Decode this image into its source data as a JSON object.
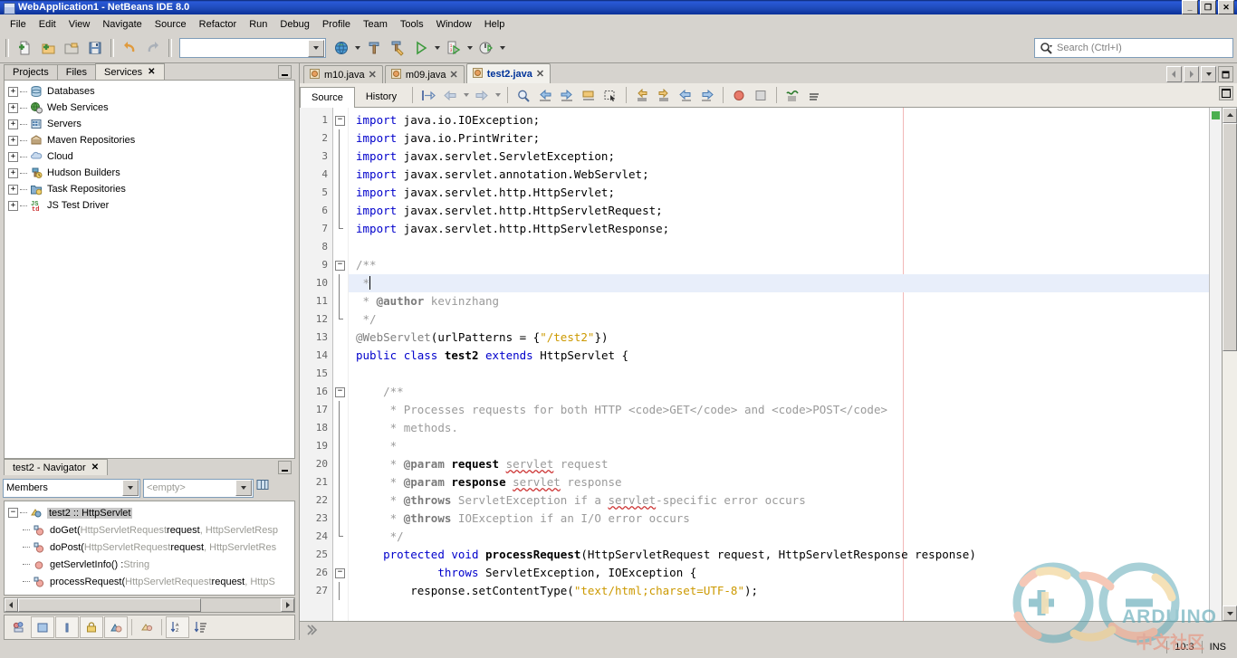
{
  "window": {
    "title": "WebApplication1 - NetBeans IDE 8.0",
    "icon": "netbeans-cube-icon",
    "minimize": "_",
    "maximize": "❐",
    "close": "✕"
  },
  "menubar": {
    "items": [
      {
        "label": "File"
      },
      {
        "label": "Edit"
      },
      {
        "label": "View"
      },
      {
        "label": "Navigate"
      },
      {
        "label": "Source"
      },
      {
        "label": "Refactor"
      },
      {
        "label": "Run"
      },
      {
        "label": "Debug"
      },
      {
        "label": "Profile"
      },
      {
        "label": "Team"
      },
      {
        "label": "Tools"
      },
      {
        "label": "Window"
      },
      {
        "label": "Help"
      }
    ]
  },
  "toolbar": {
    "buttons": [
      {
        "name": "new-file-icon",
        "title": "New File"
      },
      {
        "name": "new-project-icon",
        "title": "New Project"
      },
      {
        "name": "open-project-icon",
        "title": "Open Project"
      },
      {
        "name": "save-all-icon",
        "title": "Save All"
      },
      {
        "name": "undo-icon",
        "title": "Undo"
      },
      {
        "name": "redo-icon",
        "title": "Redo"
      },
      {
        "name": "globe-icon",
        "title": "Deploy"
      },
      {
        "name": "build-hammer-icon",
        "title": "Build Project"
      },
      {
        "name": "clean-build-icon",
        "title": "Clean and Build Project"
      },
      {
        "name": "run-project-icon",
        "title": "Run Project"
      },
      {
        "name": "debug-project-icon",
        "title": "Debug Project"
      },
      {
        "name": "profile-project-icon",
        "title": "Profile Project"
      }
    ],
    "config_combo": {
      "value": "",
      "placeholder": ""
    }
  },
  "search": {
    "placeholder": "Search (Ctrl+I)",
    "value": "",
    "icon": "search-icon"
  },
  "explorer": {
    "tabs": [
      {
        "label": "Projects",
        "active": false,
        "closable": false
      },
      {
        "label": "Files",
        "active": false,
        "closable": false
      },
      {
        "label": "Services",
        "active": true,
        "closable": true
      }
    ],
    "close_glyph": "✕",
    "tree": [
      {
        "label": "Databases",
        "icon": "database-icon",
        "expander": "+"
      },
      {
        "label": "Web Services",
        "icon": "web-services-icon",
        "expander": "+"
      },
      {
        "label": "Servers",
        "icon": "servers-icon",
        "expander": "+"
      },
      {
        "label": "Maven Repositories",
        "icon": "maven-icon",
        "expander": "+"
      },
      {
        "label": "Cloud",
        "icon": "cloud-icon",
        "expander": "+"
      },
      {
        "label": "Hudson Builders",
        "icon": "hudson-icon",
        "expander": "+"
      },
      {
        "label": "Task Repositories",
        "icon": "task-repo-icon",
        "expander": "+"
      },
      {
        "label": "JS Test Driver",
        "icon": "js-test-driver-icon",
        "expander": "+"
      }
    ]
  },
  "navigator": {
    "tab_label": "test2 - Navigator",
    "close_glyph": "✕",
    "filter_select": {
      "value": "Members",
      "arrow": "▼"
    },
    "scope_select": {
      "value": "<empty>",
      "arrow": "▼"
    },
    "view_icon": "view-columns-icon",
    "root": {
      "label": "test2 :: HttpServlet",
      "icon": "class-icon",
      "expander": "−"
    },
    "members": [
      {
        "name": "doGet",
        "signature_pre": "doGet(",
        "arg1_type": "HttpServletRequest",
        "arg1_name": " request",
        "rest": ", HttpServletResp",
        "icon": "method-protected-icon"
      },
      {
        "name": "doPost",
        "signature_pre": "doPost(",
        "arg1_type": "HttpServletRequest",
        "arg1_name": " request",
        "rest": ", HttpServletRes",
        "icon": "method-protected-icon"
      },
      {
        "name": "getServletInfo",
        "signature_pre": "getServletInfo() : ",
        "arg1_type": "String",
        "arg1_name": "",
        "rest": "",
        "icon": "method-public-icon"
      },
      {
        "name": "processRequest",
        "signature_pre": "processRequest(",
        "arg1_type": "HttpServletRequest",
        "arg1_name": " request",
        "rest": ", HttpS",
        "icon": "method-protected-icon"
      }
    ],
    "bottom_toolbar": [
      {
        "name": "filter-members-icon"
      },
      {
        "name": "show-fields-icon"
      },
      {
        "name": "show-constructors-icon"
      },
      {
        "name": "show-non-public-icon"
      },
      {
        "name": "show-static-icon"
      },
      {
        "name": "show-inherited-icon"
      },
      {
        "name": "sort-alphabetically-icon"
      },
      {
        "name": "sort-by-source-icon"
      }
    ]
  },
  "editor": {
    "tabs": [
      {
        "label": "m10.java",
        "active": false,
        "icon": "java-file-icon",
        "close": "✕"
      },
      {
        "label": "m09.java",
        "active": false,
        "icon": "java-file-icon",
        "close": "✕"
      },
      {
        "label": "test2.java",
        "active": true,
        "icon": "java-file-icon",
        "close": "✕"
      }
    ],
    "tab_nav": {
      "prev": "◀",
      "next": "▶",
      "list": "▼",
      "maximize": "maximize-icon"
    },
    "view_tabs": [
      {
        "label": "Source",
        "active": true
      },
      {
        "label": "History",
        "active": false
      }
    ],
    "toolbar_buttons": [
      {
        "name": "last-edit-icon"
      },
      {
        "name": "back-icon"
      },
      {
        "name": "forward-icon"
      },
      {
        "name": "find-selection-icon"
      },
      {
        "name": "previous-bookmark-icon"
      },
      {
        "name": "next-bookmark-icon"
      },
      {
        "name": "toggle-bookmark-icon"
      },
      {
        "name": "toggle-rectangular-selection-icon"
      },
      {
        "name": "previous-error-icon"
      },
      {
        "name": "next-error-icon"
      },
      {
        "name": "shift-left-icon"
      },
      {
        "name": "shift-right-icon"
      },
      {
        "name": "start-macro-recording-icon"
      },
      {
        "name": "stop-macro-recording-icon"
      },
      {
        "name": "comment-icon"
      },
      {
        "name": "uncomment-icon"
      }
    ],
    "breadcrumb": "",
    "breadcrumb_icon": "chevron-right-icon",
    "error_stripe_status": "ok",
    "lines": [
      {
        "n": 1,
        "fold": "box-minus",
        "html": "<span class=\"k\">import</span> java.io.IOException;"
      },
      {
        "n": 2,
        "fold": "line",
        "html": "<span class=\"k\">import</span> java.io.PrintWriter;"
      },
      {
        "n": 3,
        "fold": "line",
        "html": "<span class=\"k\">import</span> javax.servlet.ServletException;"
      },
      {
        "n": 4,
        "fold": "line",
        "html": "<span class=\"k\">import</span> javax.servlet.annotation.WebServlet;"
      },
      {
        "n": 5,
        "fold": "line",
        "html": "<span class=\"k\">import</span> javax.servlet.http.HttpServlet;"
      },
      {
        "n": 6,
        "fold": "line",
        "html": "<span class=\"k\">import</span> javax.servlet.http.HttpServletRequest;"
      },
      {
        "n": 7,
        "fold": "end",
        "html": "<span class=\"k\">import</span> javax.servlet.http.HttpServletResponse;"
      },
      {
        "n": 8,
        "fold": "",
        "html": ""
      },
      {
        "n": 9,
        "fold": "box-minus",
        "html": "<span class=\"cm\">/**</span>"
      },
      {
        "n": 10,
        "fold": "line",
        "html": " <span class=\"cm\">*</span><span class=\"cursor\"></span>",
        "highlight": true
      },
      {
        "n": 11,
        "fold": "line",
        "html": " <span class=\"cm\">* </span><span class=\"cmb\">@author</span><span class=\"cm\"> kevinzhang</span>"
      },
      {
        "n": 12,
        "fold": "end",
        "html": " <span class=\"cm\">*/</span>"
      },
      {
        "n": 13,
        "fold": "",
        "html": "<span class=\"an\">@WebServlet</span>(urlPatterns = {<span class=\"st\">\"/test2\"</span>})"
      },
      {
        "n": 14,
        "fold": "",
        "html": "<span class=\"k\">public</span> <span class=\"k\">class</span> <span class=\"kb\">test2</span> <span class=\"k\">extends</span> HttpServlet {"
      },
      {
        "n": 15,
        "fold": "",
        "html": ""
      },
      {
        "n": 16,
        "fold": "box-minus",
        "html": "    <span class=\"cm\">/**</span>"
      },
      {
        "n": 17,
        "fold": "line",
        "html": "     <span class=\"cm\">* Processes requests for both HTTP &lt;code&gt;GET&lt;/code&gt; and &lt;code&gt;POST&lt;/code&gt;</span>"
      },
      {
        "n": 18,
        "fold": "line",
        "html": "     <span class=\"cm\">* methods.</span>"
      },
      {
        "n": 19,
        "fold": "line",
        "html": "     <span class=\"cm\">*</span>"
      },
      {
        "n": 20,
        "fold": "line",
        "html": "     <span class=\"cm\">* </span><span class=\"cmb\">@param</span> <span class=\"kb\">request</span> <span class=\"cm sp\">servlet</span><span class=\"cm\"> request</span>"
      },
      {
        "n": 21,
        "fold": "line",
        "html": "     <span class=\"cm\">* </span><span class=\"cmb\">@param</span> <span class=\"kb\">response</span> <span class=\"cm sp\">servlet</span><span class=\"cm\"> response</span>"
      },
      {
        "n": 22,
        "fold": "line",
        "html": "     <span class=\"cm\">* </span><span class=\"cmb\">@throws</span><span class=\"cm\"> ServletException if a </span><span class=\"cm sp\">servlet</span><span class=\"cm\">-specific error occurs</span>"
      },
      {
        "n": 23,
        "fold": "line",
        "html": "     <span class=\"cm\">* </span><span class=\"cmb\">@throws</span><span class=\"cm\"> IOException if an I/O error occurs</span>"
      },
      {
        "n": 24,
        "fold": "end",
        "html": "     <span class=\"cm\">*/</span>"
      },
      {
        "n": 25,
        "fold": "",
        "html": "    <span class=\"k\">protected</span> <span class=\"k\">void</span> <span class=\"kb\">processRequest</span>(HttpServletRequest request, HttpServletResponse response)"
      },
      {
        "n": 26,
        "fold": "box-minus",
        "html": "            <span class=\"k\">throws</span> ServletException, IOException {"
      },
      {
        "n": 27,
        "fold": "line",
        "html": "        response.setContentType(<span class=\"st\">\"text/html;charset=UTF-8\"</span>);"
      }
    ]
  },
  "statusbar": {
    "cursor_position": "10:3",
    "insert_mode": "INS"
  },
  "watermark": {
    "brand": "ARDUINO",
    "subtitle": "中文社区"
  }
}
